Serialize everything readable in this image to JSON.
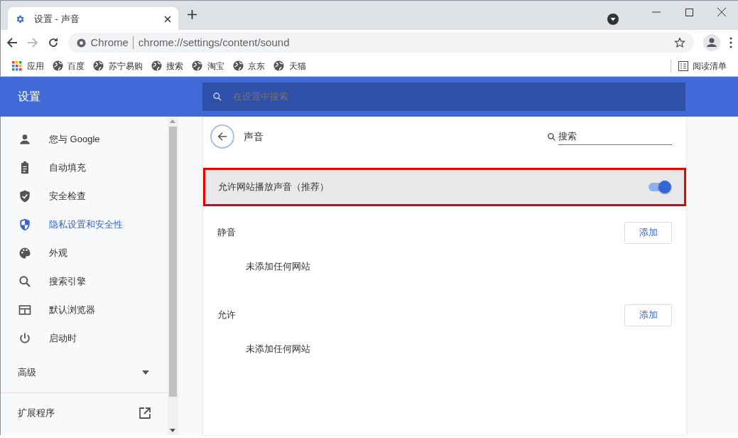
{
  "tab": {
    "title": "设置 - 声音",
    "selected": true
  },
  "address": {
    "origin": "Chrome",
    "url": "chrome://settings/content/sound"
  },
  "bookmarks": [
    {
      "kind": "apps",
      "label": "应用"
    },
    {
      "kind": "site",
      "label": "百度"
    },
    {
      "kind": "site",
      "label": "苏宁易购"
    },
    {
      "kind": "site",
      "label": "搜索"
    },
    {
      "kind": "site",
      "label": "淘宝"
    },
    {
      "kind": "site",
      "label": "京东"
    },
    {
      "kind": "site",
      "label": "天猫"
    }
  ],
  "reading_list": "阅读清单",
  "settings_header": {
    "title": "设置",
    "search_placeholder": "在设置中搜索"
  },
  "sidebar": {
    "items": [
      {
        "label": "您与 Google",
        "selected": false
      },
      {
        "label": "自动填充",
        "selected": false
      },
      {
        "label": "安全检查",
        "selected": false
      },
      {
        "label": "隐私设置和安全性",
        "selected": true
      },
      {
        "label": "外观",
        "selected": false
      },
      {
        "label": "搜索引擎",
        "selected": false
      },
      {
        "label": "默认浏览器",
        "selected": false
      },
      {
        "label": "启动时",
        "selected": false
      }
    ],
    "advanced": {
      "label": "高级",
      "expanded": false
    },
    "extensions": "扩展程序"
  },
  "page": {
    "title": "声音",
    "search_placeholder": "搜索",
    "main_toggle": {
      "label": "允许网站播放声音（推荐）",
      "on": true,
      "highlighted": true
    },
    "sections": [
      {
        "title": "静音",
        "button": "添加",
        "empty_text": "未添加任何网站"
      },
      {
        "title": "允许",
        "button": "添加",
        "empty_text": "未添加任何网站"
      }
    ]
  }
}
